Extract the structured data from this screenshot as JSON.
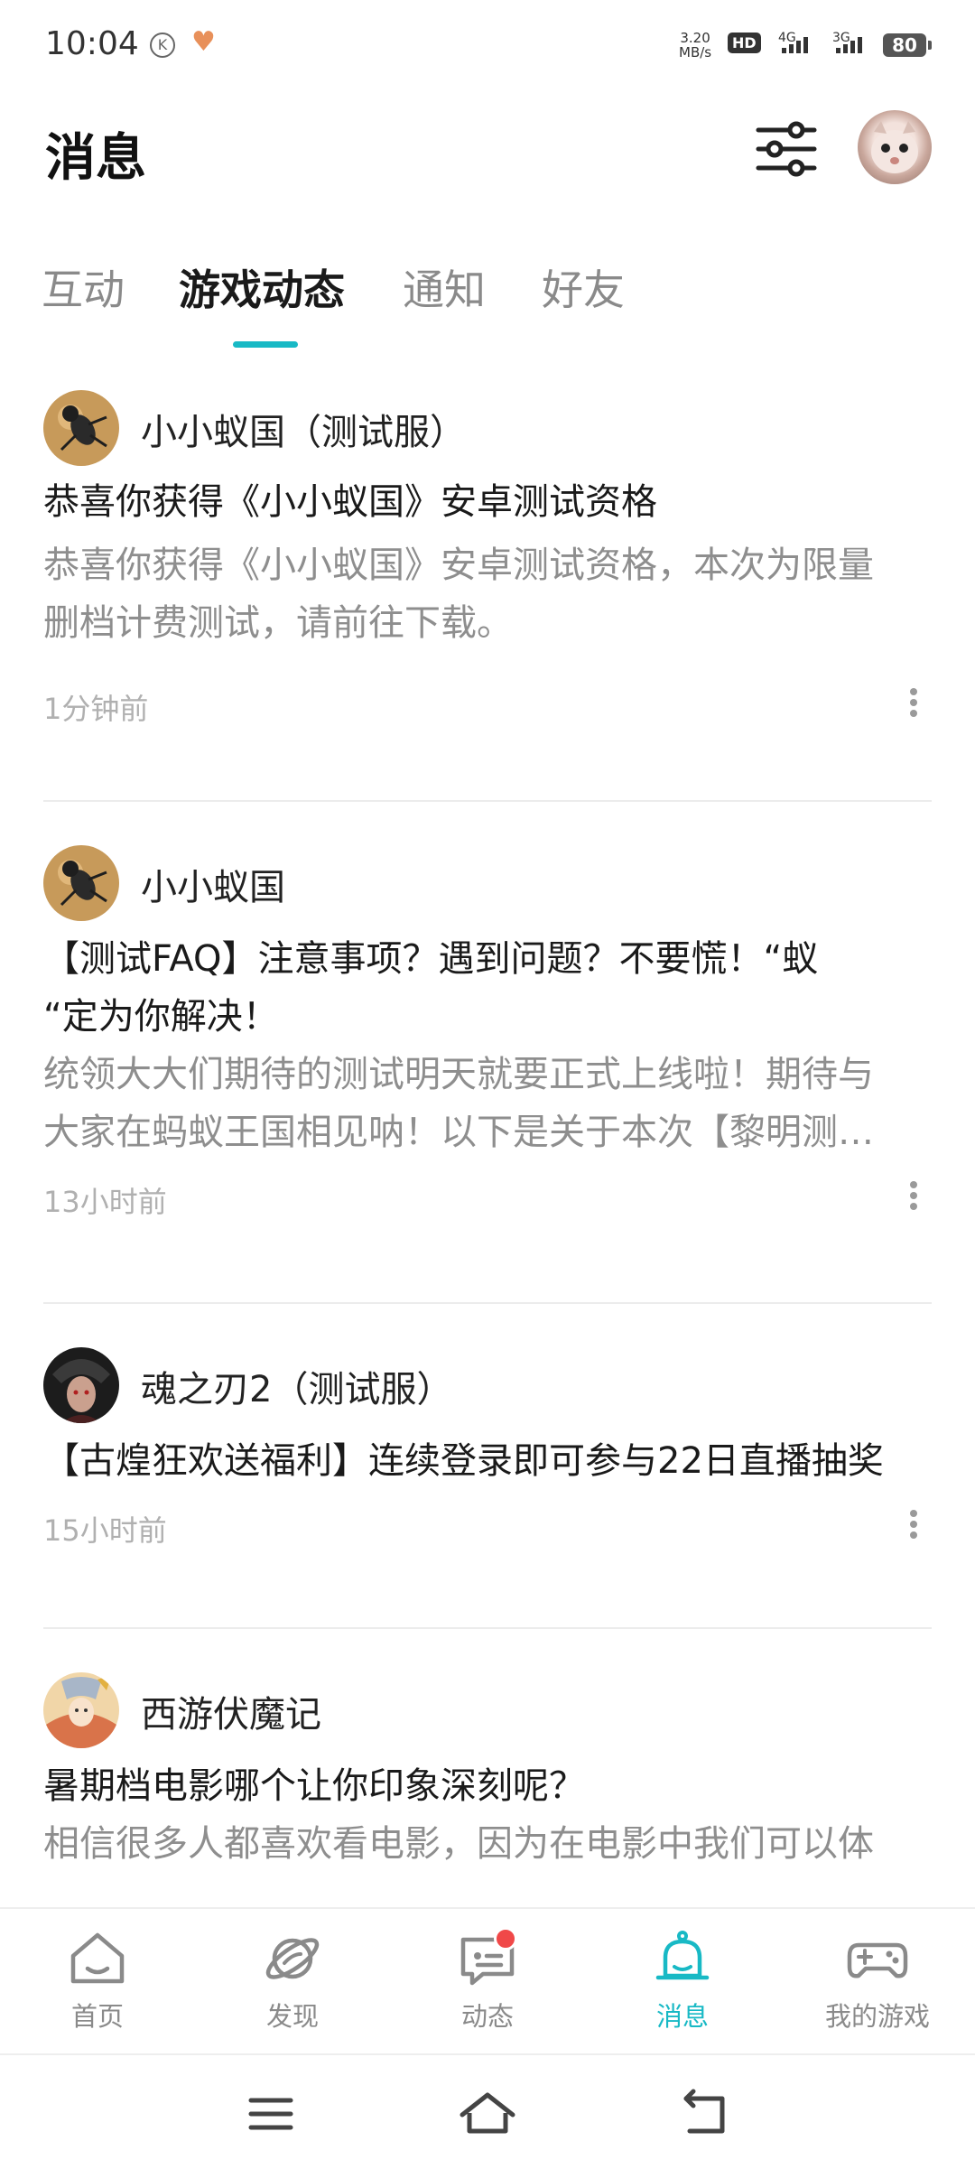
{
  "status_bar": {
    "time": "10:04",
    "k_badge": "K",
    "speed_top": "3.20",
    "speed_unit": "MB/s",
    "hd": "HD",
    "sim1_label": "4G",
    "sim2_label": "3G",
    "battery": "80"
  },
  "header": {
    "title": "消息"
  },
  "tabs": [
    {
      "label": "互动",
      "active": false
    },
    {
      "label": "游戏动态",
      "active": true
    },
    {
      "label": "通知",
      "active": false
    },
    {
      "label": "好友",
      "active": false
    }
  ],
  "feed": [
    {
      "game": "小小蚁国（测试服）",
      "title": "恭喜你获得《小小蚁国》安卓测试资格",
      "body_line1": "恭喜你获得《小小蚁国》安卓测试资格，本次为限量",
      "body_line2": "删档计费测试，请前往下载。",
      "time": "1分钟前"
    },
    {
      "game": "小小蚁国",
      "title_line1": "【测试FAQ】注意事项？遇到问题？不要慌！“蚁",
      "title_line2": "“定为你解决！",
      "body_line1": "统领大大们期待的测试明天就要正式上线啦！期待与",
      "body_line2": "大家在蚂蚁王国相见呐！以下是关于本次【黎明测…",
      "time": "13小时前"
    },
    {
      "game": "魂之刃2（测试服）",
      "title": "【古煌狂欢送福利】连续登录即可参与22日直播抽奖",
      "time": "15小时前"
    },
    {
      "game": "西游伏魔记",
      "title": "暑期档电影哪个让你印象深刻呢？",
      "body_line1": "相信很多人都喜欢看电影，因为在电影中我们可以体"
    }
  ],
  "bottom_nav": [
    {
      "label": "首页",
      "icon": "home-icon"
    },
    {
      "label": "发现",
      "icon": "planet-icon"
    },
    {
      "label": "动态",
      "icon": "chat-icon"
    },
    {
      "label": "消息",
      "icon": "bell-icon",
      "active": true
    },
    {
      "label": "我的游戏",
      "icon": "gamepad-icon"
    }
  ],
  "colors": {
    "accent": "#18b9c5",
    "badge_red": "#f04848"
  }
}
